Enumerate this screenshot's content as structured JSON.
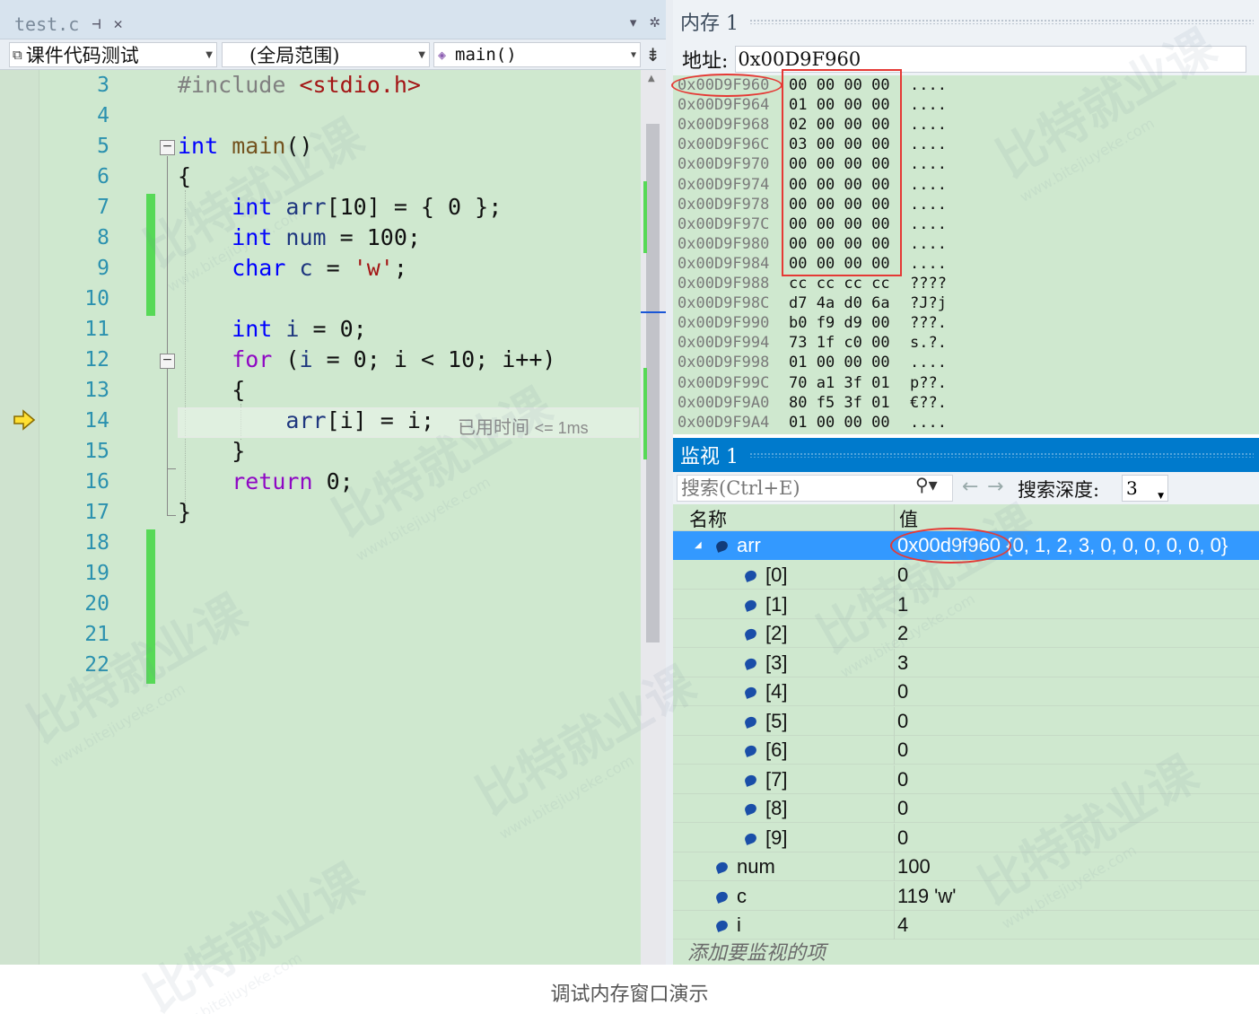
{
  "editor": {
    "tab": {
      "filename": "test.c",
      "pin_icon": "pin-icon",
      "close_icon": "close-icon"
    },
    "tabbar_right": {
      "dropdown_icon": "chevron-down-icon",
      "settings_icon": "gear-icon"
    },
    "nav": {
      "project": "课件代码测试",
      "scope": "(全局范围)",
      "member": "main()"
    },
    "line_numbers": [
      "3",
      "4",
      "5",
      "6",
      "7",
      "8",
      "9",
      "10",
      "11",
      "12",
      "13",
      "14",
      "15",
      "16",
      "17",
      "18",
      "19",
      "20",
      "21",
      "22"
    ],
    "code_lines": [
      {
        "pp": "#include ",
        "str": "<stdio.h>"
      },
      {},
      {
        "kw": "int",
        "fn": " main",
        "rest": "()"
      },
      {
        "rest": "{"
      },
      {
        "kw": "    int",
        "var": " arr",
        "rest": "[10] = { 0 };"
      },
      {
        "kw": "    int",
        "var": " num",
        "rest": " = 100;"
      },
      {
        "kw": "    char",
        "var": " c",
        "rest": " = ",
        "str": "'w'",
        "tail": ";"
      },
      {},
      {
        "kw": "    int",
        "var": " i",
        "rest": " = 0;"
      },
      {
        "kw2": "    for",
        "rest": " (",
        "var": "i",
        "tail": " = 0; i < 10; i++)"
      },
      {
        "rest": "    {"
      },
      {
        "var": "        arr",
        "rest": "[i] = ",
        "tail": "i;"
      },
      {
        "rest": "    }"
      },
      {
        "kw2": "    return",
        "rest": " 0;"
      },
      {
        "rest": "}"
      }
    ],
    "perf_tip": {
      "label": "已用时间",
      "value": "<= 1ms"
    },
    "current_line": "14"
  },
  "memory": {
    "title": "内存 1",
    "address_label": "地址:",
    "address_value": "0x00D9F960",
    "rows": [
      {
        "addr": "0x00D9F960",
        "bytes": "00 00 00 00",
        "chars": "...."
      },
      {
        "addr": "0x00D9F964",
        "bytes": "01 00 00 00",
        "chars": "...."
      },
      {
        "addr": "0x00D9F968",
        "bytes": "02 00 00 00",
        "chars": "...."
      },
      {
        "addr": "0x00D9F96C",
        "bytes": "03 00 00 00",
        "chars": "...."
      },
      {
        "addr": "0x00D9F970",
        "bytes": "00 00 00 00",
        "chars": "...."
      },
      {
        "addr": "0x00D9F974",
        "bytes": "00 00 00 00",
        "chars": "...."
      },
      {
        "addr": "0x00D9F978",
        "bytes": "00 00 00 00",
        "chars": "...."
      },
      {
        "addr": "0x00D9F97C",
        "bytes": "00 00 00 00",
        "chars": "...."
      },
      {
        "addr": "0x00D9F980",
        "bytes": "00 00 00 00",
        "chars": "...."
      },
      {
        "addr": "0x00D9F984",
        "bytes": "00 00 00 00",
        "chars": "...."
      },
      {
        "addr": "0x00D9F988",
        "bytes": "cc cc cc cc",
        "chars": "????"
      },
      {
        "addr": "0x00D9F98C",
        "bytes": "d7 4a d0 6a",
        "chars": "?J?j"
      },
      {
        "addr": "0x00D9F990",
        "bytes": "b0 f9 d9 00",
        "chars": "???."
      },
      {
        "addr": "0x00D9F994",
        "bytes": "73 1f c0 00",
        "chars": "s.?."
      },
      {
        "addr": "0x00D9F998",
        "bytes": "01 00 00 00",
        "chars": "...."
      },
      {
        "addr": "0x00D9F99C",
        "bytes": "70 a1 3f 01",
        "chars": "p??."
      },
      {
        "addr": "0x00D9F9A0",
        "bytes": "80 f5 3f 01",
        "chars": "€??."
      },
      {
        "addr": "0x00D9F9A4",
        "bytes": "01 00 00 00",
        "chars": "...."
      }
    ]
  },
  "watch": {
    "title": "监视 1",
    "search_placeholder": "搜索(Ctrl+E)",
    "depth_label": "搜索深度:",
    "depth_value": "3",
    "col_name": "名称",
    "col_value": "值",
    "arr_name": "arr",
    "arr_addr": "0x00d9f960",
    "arr_values": "{0, 1, 2, 3, 0, 0, 0, 0, 0, 0}",
    "elements": [
      {
        "name": "[0]",
        "value": "0"
      },
      {
        "name": "[1]",
        "value": "1"
      },
      {
        "name": "[2]",
        "value": "2"
      },
      {
        "name": "[3]",
        "value": "3"
      },
      {
        "name": "[4]",
        "value": "0"
      },
      {
        "name": "[5]",
        "value": "0"
      },
      {
        "name": "[6]",
        "value": "0"
      },
      {
        "name": "[7]",
        "value": "0"
      },
      {
        "name": "[8]",
        "value": "0"
      },
      {
        "name": "[9]",
        "value": "0"
      }
    ],
    "others": [
      {
        "name": "num",
        "value": "100"
      },
      {
        "name": "c",
        "value": "119 'w'"
      },
      {
        "name": "i",
        "value": "4"
      }
    ],
    "add_item": "添加要监视的项"
  },
  "caption": "调试内存窗口演示",
  "watermark": {
    "text": "比特就业课",
    "url": "www.bitejiuyeke.com"
  }
}
